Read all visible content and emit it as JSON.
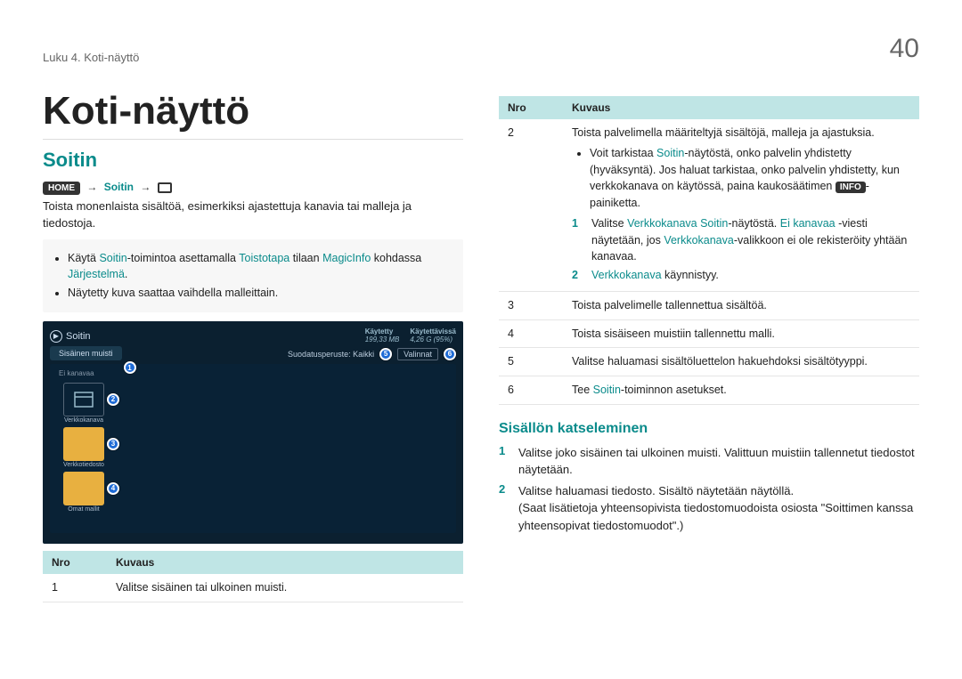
{
  "header": {
    "chapter": "Luku 4. Koti-näyttö",
    "page_number": "40"
  },
  "title": "Koti-näyttö",
  "section": "Soitin",
  "breadcrumb": {
    "home_tag": "HOME",
    "level1": "Soitin"
  },
  "lead": "Toista monenlaista sisältöä, esimerkiksi ajastettuja kanavia tai malleja ja tiedostoja.",
  "notes": {
    "item0": {
      "pre": "Käytä ",
      "hl1": "Soitin",
      "mid1": "-toimintoa asettamalla ",
      "hl2": "Toistotapa",
      "mid2": " tilaan ",
      "hl3": "MagicInfo",
      "mid3": " kohdassa ",
      "hl4": "Järjestelmä",
      "post": "."
    },
    "item1": "Näytetty kuva saattaa vaihdella malleittain."
  },
  "screenshot": {
    "title": "Soitin",
    "meta1_k": "Käytetty",
    "meta1_v": "199,33 MB",
    "meta2_k": "Käytettävissä",
    "meta2_v": "4,26 G (95%)",
    "tab": "Sisäinen muisti",
    "filter_k": "Suodatusperuste:",
    "filter_v": "Kaikki",
    "options": "Valinnat",
    "group": "Ei kanavaa",
    "item2": "Verkkokanava",
    "item3": "Verkkotiedosto",
    "item4": "Omat mallit",
    "m1": "1",
    "m2": "2",
    "m3": "3",
    "m4": "4",
    "m5": "5",
    "m6": "6"
  },
  "table_left": {
    "h_nro": "Nro",
    "h_desc": "Kuvaus",
    "rows": [
      {
        "n": "1",
        "d": "Valitse sisäinen tai ulkoinen muisti."
      }
    ]
  },
  "table_right": {
    "h_nro": "Nro",
    "h_desc": "Kuvaus",
    "rows": [
      {
        "n": "2",
        "d": "Toista palvelimella määriteltyjä sisältöjä, malleja ja ajastuksia.",
        "bullets": [
          {
            "pre": "Voit tarkistaa ",
            "hl": "Soitin",
            "mid": "-näytöstä, onko palvelin yhdistetty (hyväksyntä). Jos haluat tarkistaa, onko palvelin yhdistetty, kun verkkokanava on käytössä, paina kaukosäätimen ",
            "tag": "INFO",
            "post": "-painiketta."
          }
        ],
        "subs": [
          {
            "num": "1",
            "hl1": "Valitse ",
            "hl2": "Verkkokanava",
            "mid1": " ",
            "hl3": "Soitin",
            "mid2": "-näytöstä. ",
            "hl4": "Ei kanavaa",
            "mid3": " -viesti näytetään, jos ",
            "hl5": "Verkkokanava",
            "post": "-valikkoon ei ole rekisteröity yhtään kanavaa."
          },
          {
            "num": "2",
            "hl2": "Verkkokanava",
            "post": " käynnistyy."
          }
        ]
      },
      {
        "n": "3",
        "d": "Toista palvelimelle tallennettua sisältöä."
      },
      {
        "n": "4",
        "d": "Toista sisäiseen muistiin tallennettu malli."
      },
      {
        "n": "5",
        "d": "Valitse haluamasi sisältöluettelon hakuehdoksi sisältötyyppi."
      },
      {
        "n": "6",
        "pre": "Tee ",
        "hl": "Soitin",
        "post": "-toiminnon asetukset."
      }
    ]
  },
  "subsection": "Sisällön katseleminen",
  "content_steps": [
    {
      "num": "1",
      "text": "Valitse joko sisäinen tai ulkoinen muisti. Valittuun muistiin tallennetut tiedostot näytetään."
    },
    {
      "num": "2",
      "text": "Valitse haluamasi tiedosto. Sisältö näytetään näytöllä.",
      "extra": "(Saat lisätietoja yhteensopivista tiedostomuodoista osiosta \"Soittimen kanssa yhteensopivat tiedostomuodot\".)"
    }
  ]
}
